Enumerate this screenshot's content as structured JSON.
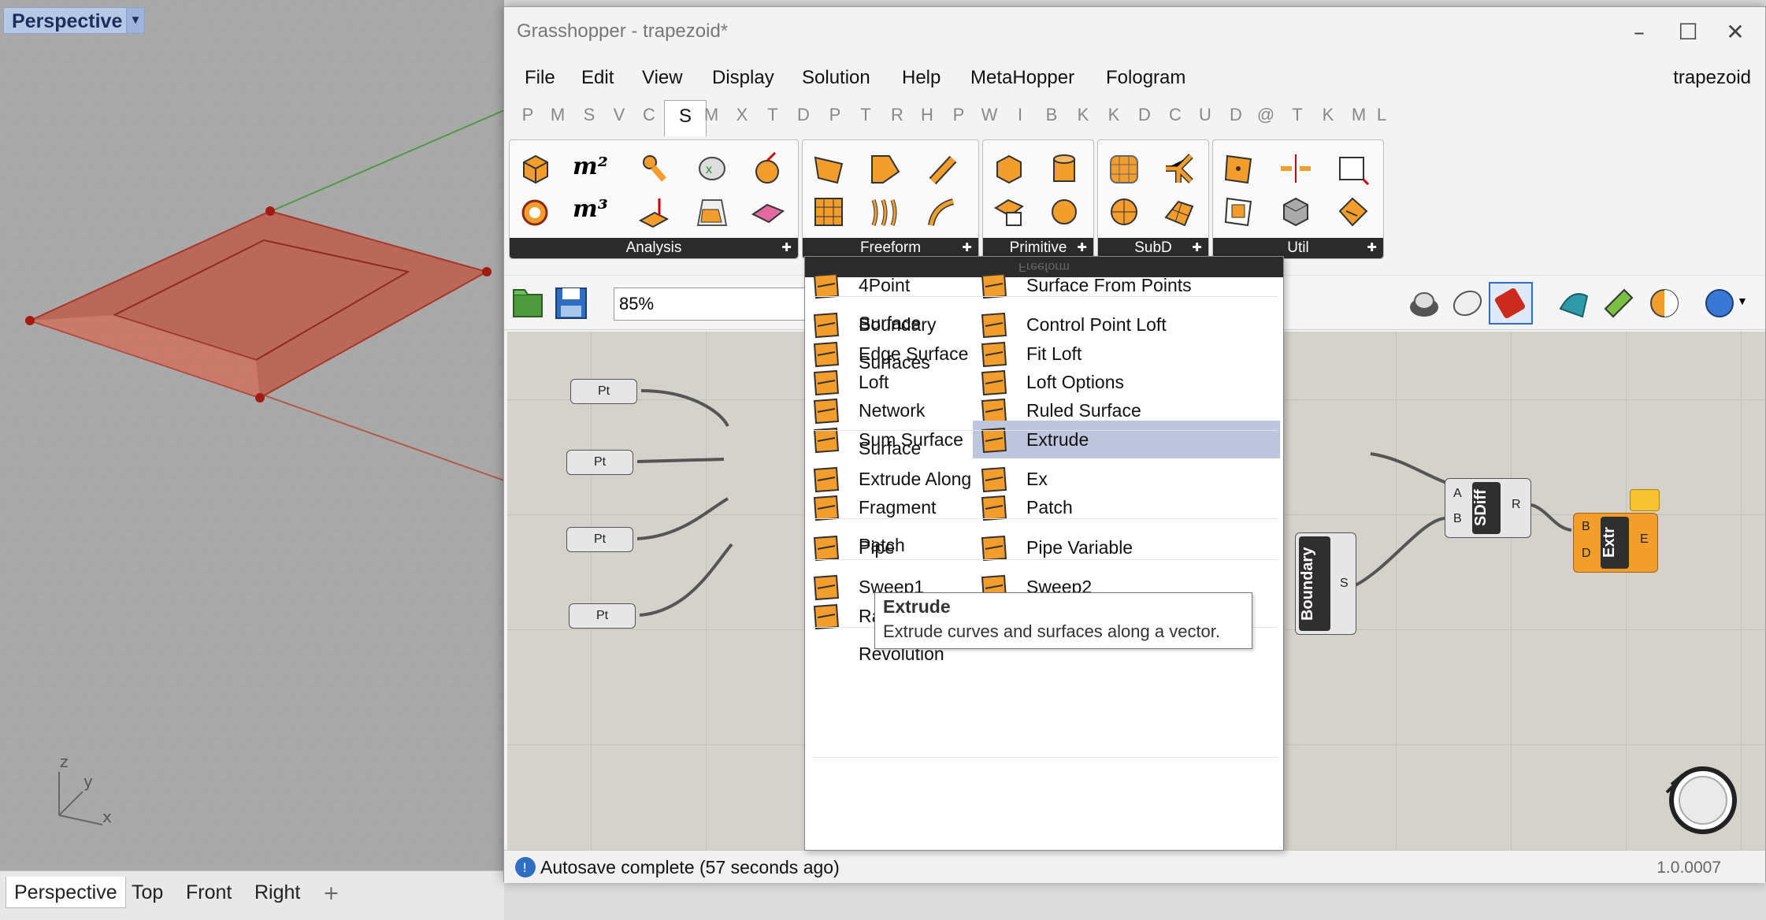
{
  "viewport": {
    "title": "Perspective",
    "axes": {
      "z": "z",
      "y": "y",
      "x": "x"
    },
    "tabs": [
      "Perspective",
      "Top",
      "Front",
      "Right"
    ],
    "add_tab_icon": "plus-icon"
  },
  "window": {
    "title": "Grasshopper - trapezoid*",
    "document": "trapezoid",
    "menu": [
      "File",
      "Edit",
      "View",
      "Display",
      "Solution",
      "Help",
      "MetaHopper",
      "Fologram"
    ],
    "tabs": [
      "P",
      "M",
      "S",
      "V",
      "C",
      "S",
      "M",
      "X",
      "T",
      "D",
      "P",
      "T",
      "R",
      "H",
      "P",
      "W",
      "I",
      "B",
      "K",
      "K",
      "D",
      "C",
      "U",
      "D",
      "@",
      "T",
      "K",
      "M",
      "L"
    ],
    "active_tab_index": 5
  },
  "ribbon": {
    "panels": [
      {
        "label": "Analysis",
        "icons": [
          "box-icon",
          "area-m2-icon",
          "pipe-measure-icon",
          "point-check-icon",
          "sphere-icon",
          "deform-icon",
          "volume-m3-icon",
          "box-measure-icon",
          "brep-icon",
          "surface-icon"
        ]
      },
      {
        "label": "Freeform",
        "icons": [
          "four-point-surface-icon",
          "boundary-surface-icon",
          "pipe-icon",
          "surface-from-points-icon",
          "loft-icon",
          "sweep-icon"
        ]
      },
      {
        "label": "Primitive",
        "icons": [
          "box-primitive-icon",
          "cylinder-icon",
          "box-rect-icon",
          "sphere-primitive-icon"
        ]
      },
      {
        "label": "SubD",
        "icons": [
          "subd-box-icon",
          "subd-branch-icon",
          "subd-sphere-icon",
          "subd-mesh-icon"
        ]
      },
      {
        "label": "Util",
        "icons": [
          "divide-surface-icon",
          "split-icon",
          "bounding-box-icon",
          "isotrim-icon",
          "brep-explode-icon",
          "offset-icon"
        ]
      }
    ]
  },
  "canvas_toolbar": {
    "zoom": "85%"
  },
  "canvas": {
    "pt_label": "Pt",
    "sdiff": {
      "label": "SDiff",
      "in_a": "A",
      "in_b": "B",
      "out": "R"
    },
    "extr": {
      "label": "Extr",
      "in_b": "B",
      "in_d": "D",
      "out": "E"
    },
    "boundary": {
      "label": "Boundary",
      "out": "S"
    }
  },
  "dropdown": {
    "header": "Freeform",
    "items": [
      {
        "label": "4Point Surface",
        "icon": "four-point-surface-icon"
      },
      {
        "label": "Surface From Points",
        "icon": "surface-from-points-icon"
      },
      {
        "label": "Boundary Surfaces",
        "icon": "boundary-surfaces-icon"
      },
      {
        "label": "Control Point Loft",
        "icon": "control-point-loft-icon"
      },
      {
        "label": "Edge Surface",
        "icon": "edge-surface-icon"
      },
      {
        "label": "Fit Loft",
        "icon": "fit-loft-icon"
      },
      {
        "label": "Loft",
        "icon": "loft-icon"
      },
      {
        "label": "Loft Options",
        "icon": "loft-options-icon"
      },
      {
        "label": "Network Surface",
        "icon": "network-surface-icon"
      },
      {
        "label": "Ruled Surface",
        "icon": "ruled-surface-icon"
      },
      {
        "label": "Sum Surface",
        "icon": "sum-surface-icon"
      },
      {
        "label": "Extrude",
        "icon": "extrude-icon"
      },
      {
        "label": "Extrude Along",
        "icon": "extrude-along-icon"
      },
      {
        "label": "Ex",
        "icon": "extrude-point-icon"
      },
      {
        "label": "Fragment Patch",
        "icon": "fragment-patch-icon"
      },
      {
        "label": "Patch",
        "icon": "patch-icon"
      },
      {
        "label": "Pipe",
        "icon": "pipe-icon"
      },
      {
        "label": "Pipe Variable",
        "icon": "pipe-variable-icon"
      },
      {
        "label": "Sweep1",
        "icon": "sweep1-icon"
      },
      {
        "label": "Sweep2",
        "icon": "sweep2-icon"
      },
      {
        "label": "Rail Revolution",
        "icon": "rail-revolution-icon"
      },
      {
        "label": "Revolution",
        "icon": "revolution-icon"
      }
    ],
    "tooltip": {
      "title": "Extrude",
      "description": "Extrude curves and surfaces along a vector."
    }
  },
  "status": {
    "message": "Autosave complete (57 seconds ago)",
    "version": "1.0.0007"
  },
  "colors": {
    "accent_orange": "#f29d2c",
    "surface_red": "#c0533f",
    "highlight": "#bdc6dd"
  }
}
